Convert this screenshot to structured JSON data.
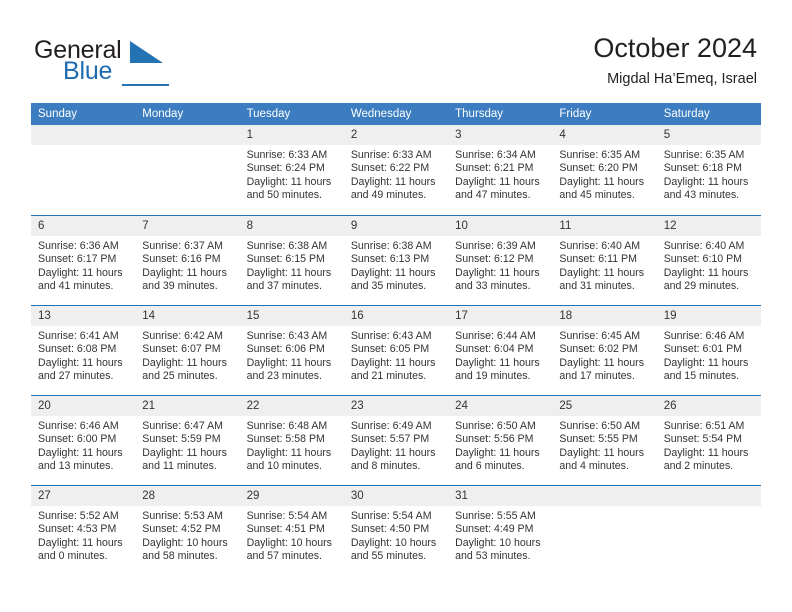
{
  "brand": {
    "name_top": "General",
    "name_bottom": "Blue",
    "accent_color": "#2272b4",
    "logo_icon": "triangle-icon"
  },
  "header": {
    "title": "October 2024",
    "subtitle": "Migdal Ha’Emeq, Israel"
  },
  "calendar": {
    "header_bg": "#3b7dc0",
    "day_band_bg": "#efefef",
    "row_rule_color": "#2272b4",
    "weekdays": [
      "Sunday",
      "Monday",
      "Tuesday",
      "Wednesday",
      "Thursday",
      "Friday",
      "Saturday"
    ],
    "weeks": [
      [
        {
          "day": "",
          "empty": true,
          "sunrise": "",
          "sunset": "",
          "daylight_1": "",
          "daylight_2": ""
        },
        {
          "day": "",
          "empty": true,
          "sunrise": "",
          "sunset": "",
          "daylight_1": "",
          "daylight_2": ""
        },
        {
          "day": "1",
          "sunrise": "Sunrise: 6:33 AM",
          "sunset": "Sunset: 6:24 PM",
          "daylight_1": "Daylight: 11 hours",
          "daylight_2": "and 50 minutes."
        },
        {
          "day": "2",
          "sunrise": "Sunrise: 6:33 AM",
          "sunset": "Sunset: 6:22 PM",
          "daylight_1": "Daylight: 11 hours",
          "daylight_2": "and 49 minutes."
        },
        {
          "day": "3",
          "sunrise": "Sunrise: 6:34 AM",
          "sunset": "Sunset: 6:21 PM",
          "daylight_1": "Daylight: 11 hours",
          "daylight_2": "and 47 minutes."
        },
        {
          "day": "4",
          "sunrise": "Sunrise: 6:35 AM",
          "sunset": "Sunset: 6:20 PM",
          "daylight_1": "Daylight: 11 hours",
          "daylight_2": "and 45 minutes."
        },
        {
          "day": "5",
          "sunrise": "Sunrise: 6:35 AM",
          "sunset": "Sunset: 6:18 PM",
          "daylight_1": "Daylight: 11 hours",
          "daylight_2": "and 43 minutes."
        }
      ],
      [
        {
          "day": "6",
          "sunrise": "Sunrise: 6:36 AM",
          "sunset": "Sunset: 6:17 PM",
          "daylight_1": "Daylight: 11 hours",
          "daylight_2": "and 41 minutes."
        },
        {
          "day": "7",
          "sunrise": "Sunrise: 6:37 AM",
          "sunset": "Sunset: 6:16 PM",
          "daylight_1": "Daylight: 11 hours",
          "daylight_2": "and 39 minutes."
        },
        {
          "day": "8",
          "sunrise": "Sunrise: 6:38 AM",
          "sunset": "Sunset: 6:15 PM",
          "daylight_1": "Daylight: 11 hours",
          "daylight_2": "and 37 minutes."
        },
        {
          "day": "9",
          "sunrise": "Sunrise: 6:38 AM",
          "sunset": "Sunset: 6:13 PM",
          "daylight_1": "Daylight: 11 hours",
          "daylight_2": "and 35 minutes."
        },
        {
          "day": "10",
          "sunrise": "Sunrise: 6:39 AM",
          "sunset": "Sunset: 6:12 PM",
          "daylight_1": "Daylight: 11 hours",
          "daylight_2": "and 33 minutes."
        },
        {
          "day": "11",
          "sunrise": "Sunrise: 6:40 AM",
          "sunset": "Sunset: 6:11 PM",
          "daylight_1": "Daylight: 11 hours",
          "daylight_2": "and 31 minutes."
        },
        {
          "day": "12",
          "sunrise": "Sunrise: 6:40 AM",
          "sunset": "Sunset: 6:10 PM",
          "daylight_1": "Daylight: 11 hours",
          "daylight_2": "and 29 minutes."
        }
      ],
      [
        {
          "day": "13",
          "sunrise": "Sunrise: 6:41 AM",
          "sunset": "Sunset: 6:08 PM",
          "daylight_1": "Daylight: 11 hours",
          "daylight_2": "and 27 minutes."
        },
        {
          "day": "14",
          "sunrise": "Sunrise: 6:42 AM",
          "sunset": "Sunset: 6:07 PM",
          "daylight_1": "Daylight: 11 hours",
          "daylight_2": "and 25 minutes."
        },
        {
          "day": "15",
          "sunrise": "Sunrise: 6:43 AM",
          "sunset": "Sunset: 6:06 PM",
          "daylight_1": "Daylight: 11 hours",
          "daylight_2": "and 23 minutes."
        },
        {
          "day": "16",
          "sunrise": "Sunrise: 6:43 AM",
          "sunset": "Sunset: 6:05 PM",
          "daylight_1": "Daylight: 11 hours",
          "daylight_2": "and 21 minutes."
        },
        {
          "day": "17",
          "sunrise": "Sunrise: 6:44 AM",
          "sunset": "Sunset: 6:04 PM",
          "daylight_1": "Daylight: 11 hours",
          "daylight_2": "and 19 minutes."
        },
        {
          "day": "18",
          "sunrise": "Sunrise: 6:45 AM",
          "sunset": "Sunset: 6:02 PM",
          "daylight_1": "Daylight: 11 hours",
          "daylight_2": "and 17 minutes."
        },
        {
          "day": "19",
          "sunrise": "Sunrise: 6:46 AM",
          "sunset": "Sunset: 6:01 PM",
          "daylight_1": "Daylight: 11 hours",
          "daylight_2": "and 15 minutes."
        }
      ],
      [
        {
          "day": "20",
          "sunrise": "Sunrise: 6:46 AM",
          "sunset": "Sunset: 6:00 PM",
          "daylight_1": "Daylight: 11 hours",
          "daylight_2": "and 13 minutes."
        },
        {
          "day": "21",
          "sunrise": "Sunrise: 6:47 AM",
          "sunset": "Sunset: 5:59 PM",
          "daylight_1": "Daylight: 11 hours",
          "daylight_2": "and 11 minutes."
        },
        {
          "day": "22",
          "sunrise": "Sunrise: 6:48 AM",
          "sunset": "Sunset: 5:58 PM",
          "daylight_1": "Daylight: 11 hours",
          "daylight_2": "and 10 minutes."
        },
        {
          "day": "23",
          "sunrise": "Sunrise: 6:49 AM",
          "sunset": "Sunset: 5:57 PM",
          "daylight_1": "Daylight: 11 hours",
          "daylight_2": "and 8 minutes."
        },
        {
          "day": "24",
          "sunrise": "Sunrise: 6:50 AM",
          "sunset": "Sunset: 5:56 PM",
          "daylight_1": "Daylight: 11 hours",
          "daylight_2": "and 6 minutes."
        },
        {
          "day": "25",
          "sunrise": "Sunrise: 6:50 AM",
          "sunset": "Sunset: 5:55 PM",
          "daylight_1": "Daylight: 11 hours",
          "daylight_2": "and 4 minutes."
        },
        {
          "day": "26",
          "sunrise": "Sunrise: 6:51 AM",
          "sunset": "Sunset: 5:54 PM",
          "daylight_1": "Daylight: 11 hours",
          "daylight_2": "and 2 minutes."
        }
      ],
      [
        {
          "day": "27",
          "sunrise": "Sunrise: 5:52 AM",
          "sunset": "Sunset: 4:53 PM",
          "daylight_1": "Daylight: 11 hours",
          "daylight_2": "and 0 minutes."
        },
        {
          "day": "28",
          "sunrise": "Sunrise: 5:53 AM",
          "sunset": "Sunset: 4:52 PM",
          "daylight_1": "Daylight: 10 hours",
          "daylight_2": "and 58 minutes."
        },
        {
          "day": "29",
          "sunrise": "Sunrise: 5:54 AM",
          "sunset": "Sunset: 4:51 PM",
          "daylight_1": "Daylight: 10 hours",
          "daylight_2": "and 57 minutes."
        },
        {
          "day": "30",
          "sunrise": "Sunrise: 5:54 AM",
          "sunset": "Sunset: 4:50 PM",
          "daylight_1": "Daylight: 10 hours",
          "daylight_2": "and 55 minutes."
        },
        {
          "day": "31",
          "sunrise": "Sunrise: 5:55 AM",
          "sunset": "Sunset: 4:49 PM",
          "daylight_1": "Daylight: 10 hours",
          "daylight_2": "and 53 minutes."
        },
        {
          "day": "",
          "empty": true,
          "sunrise": "",
          "sunset": "",
          "daylight_1": "",
          "daylight_2": ""
        },
        {
          "day": "",
          "empty": true,
          "sunrise": "",
          "sunset": "",
          "daylight_1": "",
          "daylight_2": ""
        }
      ]
    ]
  }
}
